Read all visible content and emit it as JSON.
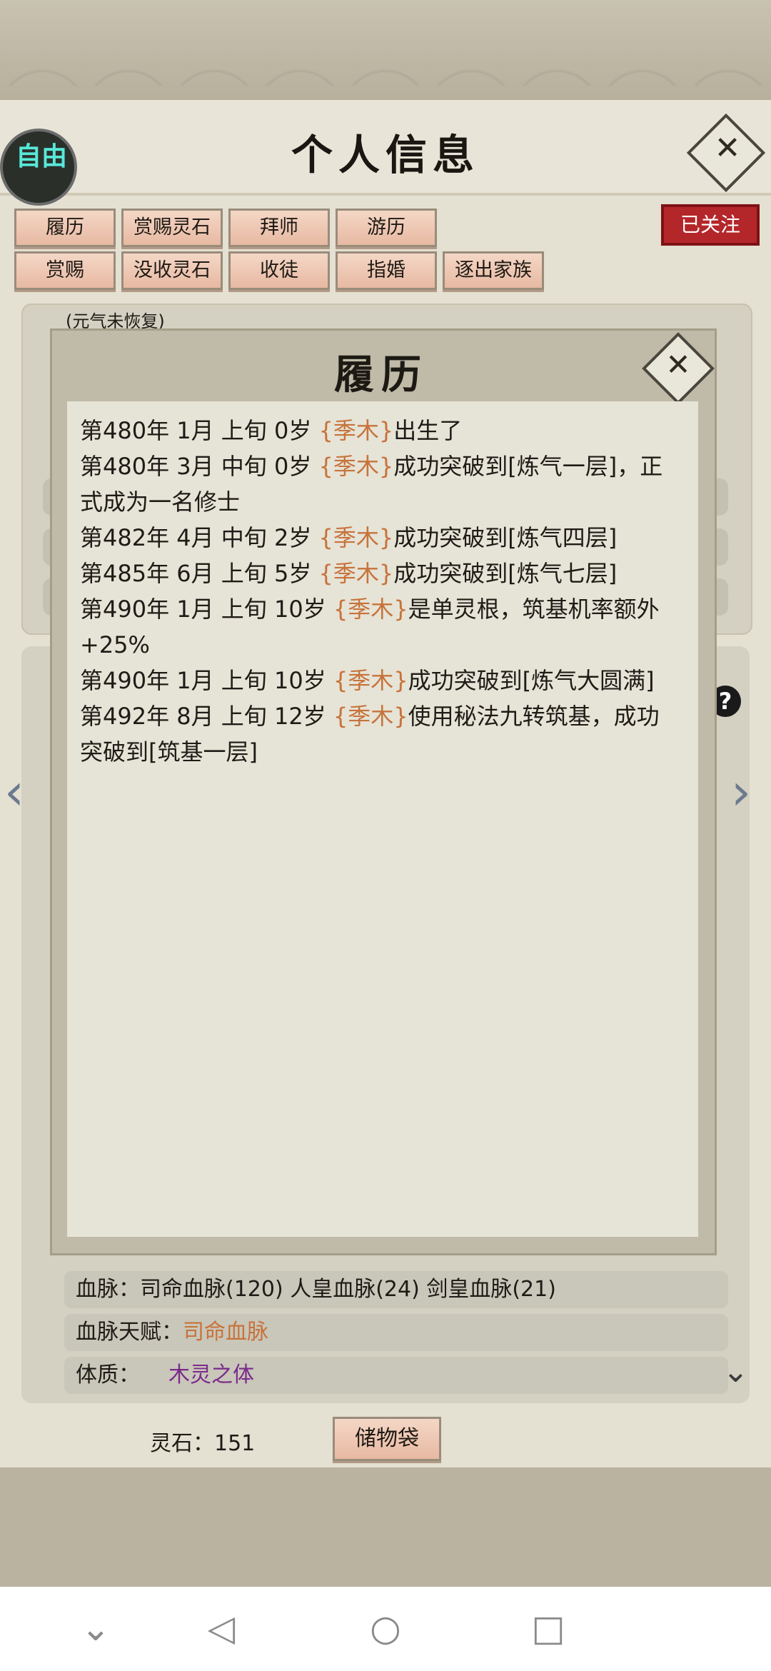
{
  "header": {
    "title": "个人信息",
    "free_badge": "自由"
  },
  "action_buttons_row1": [
    "履历",
    "赏赐灵石",
    "拜师",
    "游历"
  ],
  "action_buttons_row2": [
    "赏赐",
    "没收灵石",
    "收徒",
    "指婚",
    "逐出家族"
  ],
  "follow_status": "已关注",
  "status_hint": "(元气未恢复)",
  "modal": {
    "title": "履历",
    "entries": [
      {
        "prefix": "第480年 1月 上旬  0岁 ",
        "name": "{季木}",
        "suffix": "出生了"
      },
      {
        "prefix": "第480年 3月 中旬  0岁 ",
        "name": "{季木}",
        "suffix": "成功突破到[炼气一层]，正式成为一名修士"
      },
      {
        "prefix": "第482年 4月 中旬  2岁 ",
        "name": "{季木}",
        "suffix": "成功突破到[炼气四层]"
      },
      {
        "prefix": "第485年 6月 上旬  5岁 ",
        "name": "{季木}",
        "suffix": "成功突破到[炼气七层]"
      },
      {
        "prefix": "第490年 1月 上旬  10岁 ",
        "name": "{季木}",
        "suffix": "是单灵根，筑基机率额外+25%"
      },
      {
        "prefix": "第490年 1月 上旬 10岁 ",
        "name": "{季木}",
        "suffix": "成功突破到[炼气大圆满]"
      },
      {
        "prefix": "第492年 8月 上旬  12岁 ",
        "name": "{季木}",
        "suffix": "使用秘法九转筑基，成功突破到[筑基一层]"
      }
    ]
  },
  "bloodline": {
    "label": "血脉：",
    "value": "司命血脉(120)   人皇血脉(24)    剑皇血脉(21)"
  },
  "bloodline_talent": {
    "label": "血脉天赋：",
    "value": "司命血脉"
  },
  "physique": {
    "label": "体质：",
    "value": "木灵之体"
  },
  "spirit_stones": "灵石：151",
  "storage_bag": "储物袋",
  "colors": {
    "name": "#c7733a",
    "accent_red": "#b3262a",
    "purple": "#7a2a8a"
  },
  "icons": {
    "close": "close-icon",
    "help": "help-icon",
    "left": "chevron-left-icon",
    "right": "chevron-right-icon",
    "more": "double-chevron-down-icon"
  }
}
